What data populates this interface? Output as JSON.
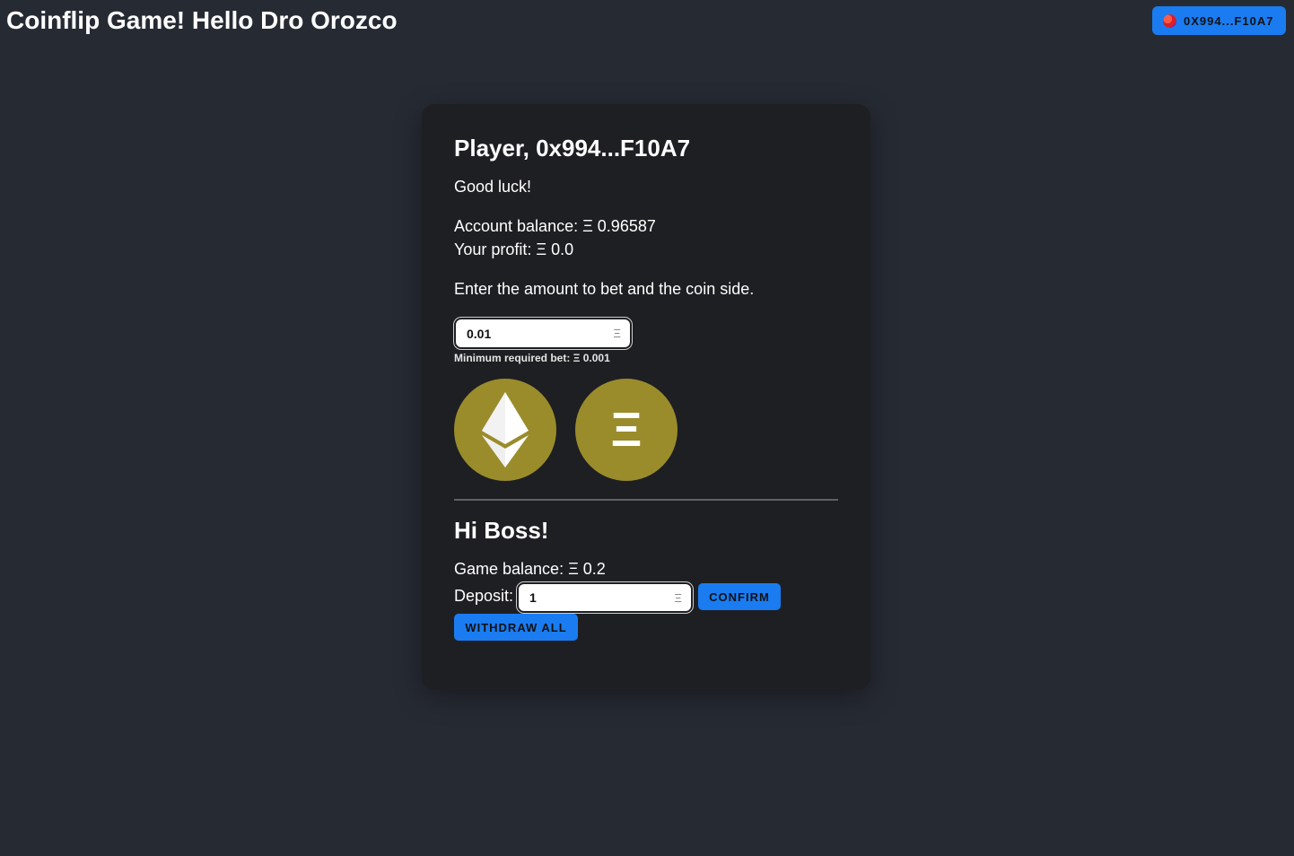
{
  "header": {
    "title": "Coinflip Game! Hello Dro Orozco",
    "wallet_label": "0X994...F10A7"
  },
  "player": {
    "title": "Player, 0x994...F10A7",
    "greeting": "Good luck!",
    "balance_label": "Account balance: Ξ 0.96587",
    "profit_label": "Your profit: Ξ 0.0",
    "instruction": "Enter the amount to bet and the coin side."
  },
  "bet": {
    "value": "0.01",
    "unit": "Ξ",
    "min_text": "Minimum required bet: Ξ 0.001"
  },
  "coins": {
    "heads_icon": "ethereum-diamond-icon",
    "tails_glyph": "Ξ",
    "color": "#9a8c2b"
  },
  "boss": {
    "title": "Hi Boss!",
    "game_balance": "Game balance: Ξ 0.2",
    "deposit_label": "Deposit:",
    "deposit_value": "1",
    "deposit_unit": "Ξ",
    "confirm_label": "CONFIRM",
    "withdraw_label": "WITHDRAW ALL"
  },
  "colors": {
    "background": "#262a33",
    "card": "#1e1f23",
    "accent": "#1a7cf0",
    "coin": "#9a8c2b"
  }
}
